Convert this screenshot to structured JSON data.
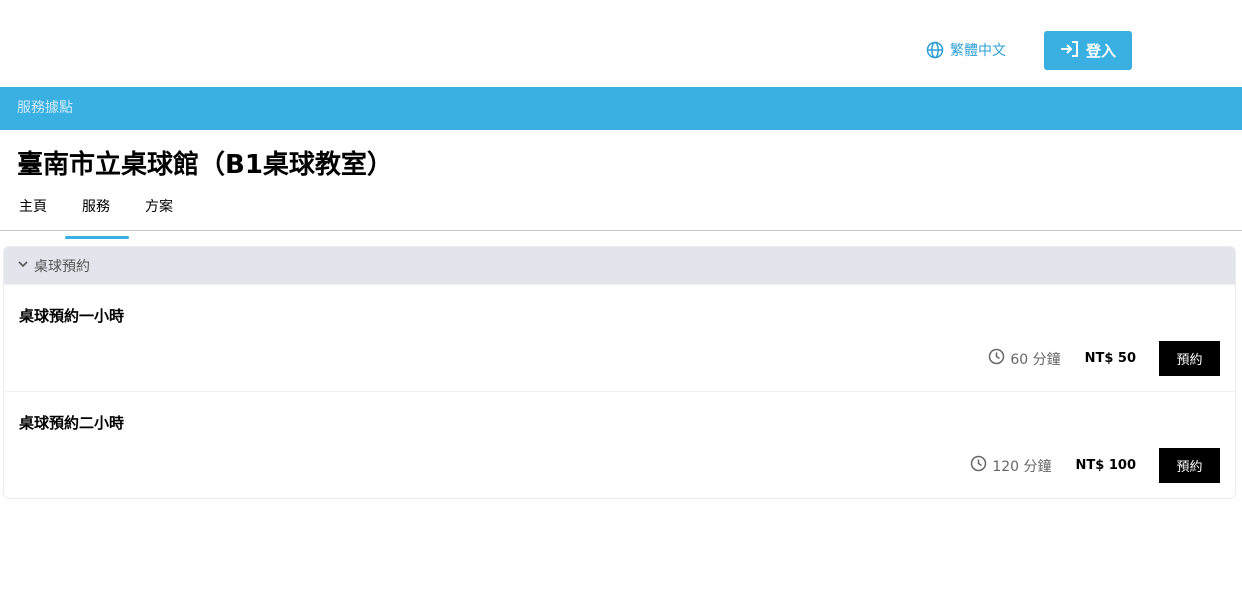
{
  "header": {
    "language_label": "繁體中文",
    "login_label": "登入"
  },
  "banner": {
    "label": "服務據點"
  },
  "page": {
    "title": "臺南市立桌球館（B1桌球教室）"
  },
  "tabs": [
    {
      "label": "主頁",
      "active": false
    },
    {
      "label": "服務",
      "active": true
    },
    {
      "label": "方案",
      "active": false
    }
  ],
  "category": {
    "label": "桌球預約",
    "expanded": true
  },
  "services": [
    {
      "name": "桌球預約一小時",
      "duration": "60 分鐘",
      "price": "NT$ 50",
      "button_label": "預約"
    },
    {
      "name": "桌球預約二小時",
      "duration": "120 分鐘",
      "price": "NT$ 100",
      "button_label": "預約"
    }
  ],
  "colors": {
    "accent": "#3ab0e2",
    "link": "#2d9fd6",
    "category_bg": "#e4e5ec",
    "button_dark": "#000000"
  },
  "icons": {
    "language": "globe-icon",
    "login": "login-arrow-icon",
    "category": "chevron-down-icon",
    "duration": "clock-icon"
  }
}
